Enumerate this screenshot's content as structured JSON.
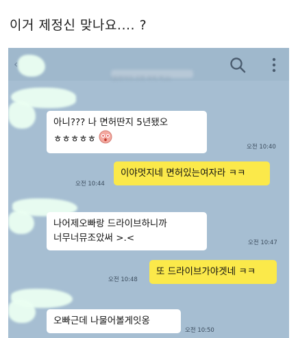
{
  "caption": "이거 제정신 맞나요.... ?",
  "header": {
    "back_label": "‹",
    "title": "(말한여자 오한 마직 학교)",
    "search_icon": "search-icon",
    "more_icon": "more-vertical-icon"
  },
  "messages": [
    {
      "from": "them",
      "lines": [
        "아니??? 나 면허딴지 5년됐오",
        "ㅎㅎㅎㅎㅎ"
      ],
      "time": "오전 10:40",
      "emoji": "surprised-face-emoji"
    },
    {
      "from": "me",
      "lines": [
        "이야멋지네 면허있는여자라 ㅋㅋ"
      ],
      "time": "오전 10:44"
    },
    {
      "from": "them",
      "lines": [
        "나어제오빠랑 드라이브하니까",
        "너무너뮤조았써 >.<"
      ],
      "time": "오전 10:47"
    },
    {
      "from": "me",
      "lines": [
        "또 드라이브가야겟네 ㅋㅋ"
      ],
      "time": "오전 10:48"
    },
    {
      "from": "them",
      "lines": [
        "오빠근데 나물어볼게잇옹"
      ],
      "time": "오전 10:50"
    }
  ]
}
